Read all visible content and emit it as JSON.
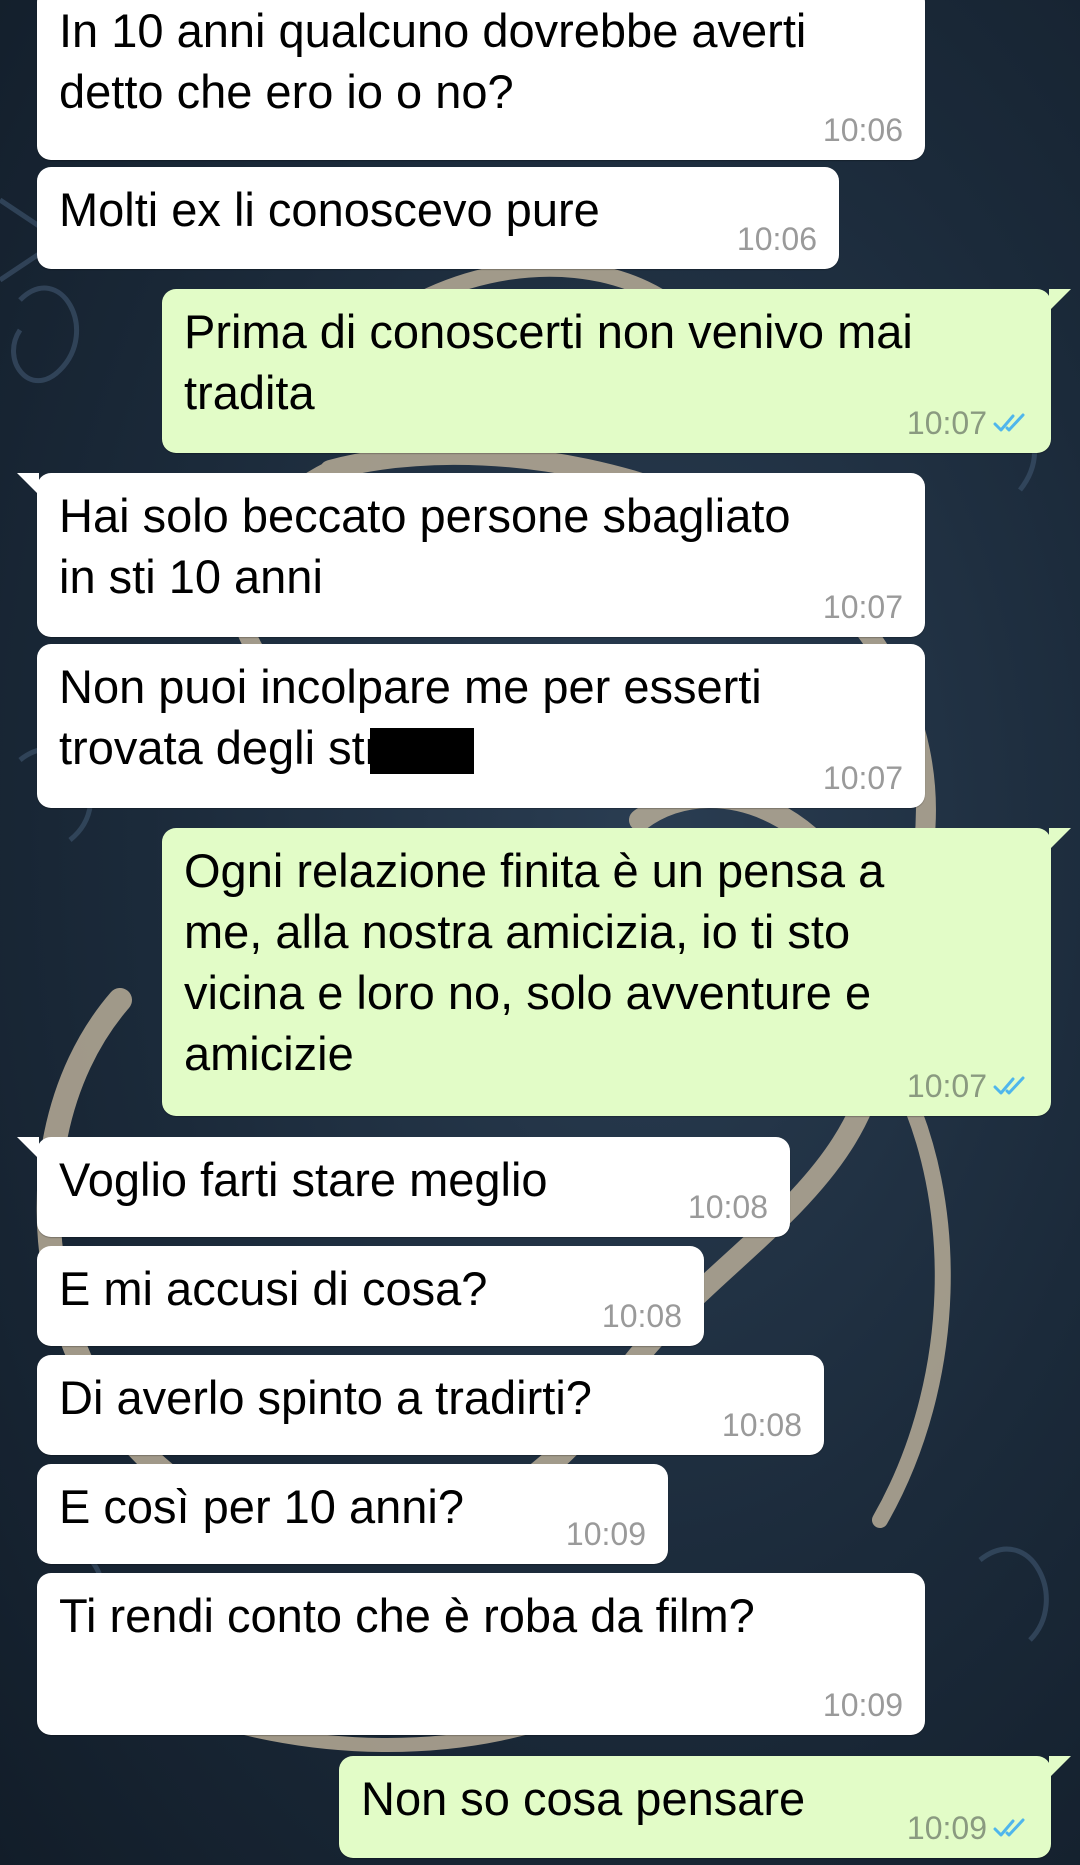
{
  "colors": {
    "incoming_bubble": "#ffffff",
    "outgoing_bubble": "#e2fcc7",
    "read_ticks": "#4fb6ec",
    "wallpaper": "#1b2a3a"
  },
  "messages": [
    {
      "direction": "in",
      "lines": [
        "In 10 anni qualcuno dovrebbe averti",
        "detto che ero io o no?"
      ],
      "time": "10:06"
    },
    {
      "direction": "in",
      "lines": [
        "Molti ex li conoscevo pure"
      ],
      "time": "10:06"
    },
    {
      "direction": "out",
      "lines": [
        "Prima di conoscerti non venivo mai",
        "tradita"
      ],
      "time": "10:07",
      "status": "read"
    },
    {
      "direction": "in",
      "lines": [
        "Hai solo beccato persone sbagliato",
        "in sti 10 anni"
      ],
      "time": "10:07"
    },
    {
      "direction": "in",
      "lines": [
        "Non puoi incolpare me per esserti",
        "trovata degli str"
      ],
      "time": "10:07",
      "redacted": true
    },
    {
      "direction": "out",
      "lines": [
        "Ogni relazione finita è un pensa a",
        "me, alla nostra amicizia, io ti sto",
        "vicina e loro no, solo avventure e",
        "amicizie"
      ],
      "time": "10:07",
      "status": "read"
    },
    {
      "direction": "in",
      "lines": [
        "Voglio farti stare meglio"
      ],
      "time": "10:08"
    },
    {
      "direction": "in",
      "lines": [
        "E mi accusi di cosa?"
      ],
      "time": "10:08"
    },
    {
      "direction": "in",
      "lines": [
        "Di averlo spinto a tradirti?"
      ],
      "time": "10:08"
    },
    {
      "direction": "in",
      "lines": [
        "E così per 10 anni?"
      ],
      "time": "10:09"
    },
    {
      "direction": "in",
      "lines": [
        "Ti rendi conto che è roba da film?"
      ],
      "time": "10:09"
    },
    {
      "direction": "out",
      "lines": [
        "Non so cosa pensare"
      ],
      "time": "10:09",
      "status": "read"
    }
  ]
}
